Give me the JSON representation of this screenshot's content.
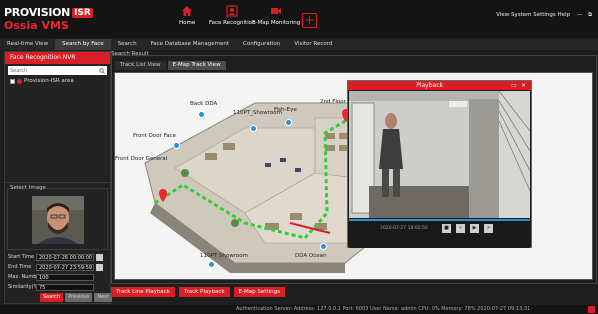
{
  "brand": {
    "name": "PROVISION",
    "badge": "ISR",
    "product": "Ossia VMS"
  },
  "nav": [
    {
      "label": "Home"
    },
    {
      "label": "Face Recognition"
    },
    {
      "label": "E-Map Monitoring"
    }
  ],
  "system_menu": "View System Settings Help",
  "tabs": [
    "Real-time View",
    "Search by Face",
    "Search",
    "Face Database Management",
    "Configuration",
    "Visitor Record"
  ],
  "left": {
    "header": "Face Recognition NVR",
    "search_placeholder": "Search",
    "tree_item": "Provision-ISR area",
    "select_image_label": "Select Image",
    "start_time_label": "Start Time",
    "start_time": "2020-07-26 00:00:00",
    "end_time_label": "End Time",
    "end_time": "2020-07-27 23:59:59",
    "max_number_label": "Max. Number",
    "max_number": "100",
    "similarity_label": "Similarity(%)",
    "similarity": "75",
    "search_btn": "Search",
    "previous_btn": "Previous",
    "next_btn": "Next"
  },
  "main": {
    "result_label": "Search Result",
    "subtabs": [
      "Track List View",
      "E-Map Track View"
    ],
    "map_labels": {
      "back_dda": "Back DDA",
      "showroom": "110PT_Showroom",
      "fish_eye": "Fish-Eye",
      "second_floor": "2nd Floor",
      "front_door_face": "Front Door Face",
      "front_door_gen": "Front Door General",
      "dda_ocean": "DDA Ocean",
      "pt_bottom": "110PT Showroom"
    },
    "bottom_buttons": [
      "Track Line Playback",
      "Track Playback",
      "E-Map Settings"
    ]
  },
  "playback": {
    "title": "Playback",
    "timestamp": "2020-07-27 18:02:50",
    "controls": [
      "minimize",
      "close"
    ]
  },
  "status": {
    "text": "Authentication Server: Address: 127.0.0.1     Port: 6003     User Name: admin     CPU: 0%     Memory: 78%     2020-07-27 09:13:31"
  },
  "colors": {
    "accent": "#d81f26",
    "track": "#33cc33",
    "camera": "#2a8fd8"
  }
}
